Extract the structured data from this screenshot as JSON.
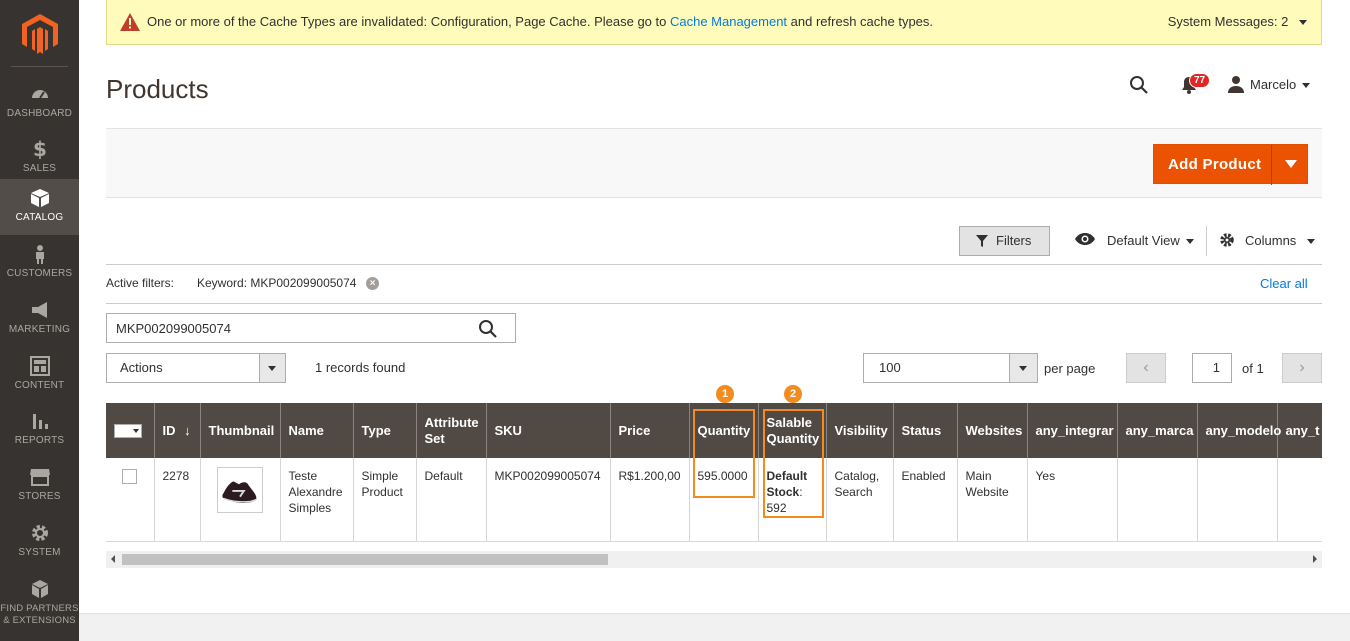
{
  "sidebar": {
    "items": [
      {
        "label": "Dashboard",
        "icon": "dashboard-icon"
      },
      {
        "label": "Sales",
        "icon": "dollar-icon"
      },
      {
        "label": "Catalog",
        "icon": "box-icon"
      },
      {
        "label": "Customers",
        "icon": "person-icon"
      },
      {
        "label": "Marketing",
        "icon": "megaphone-icon"
      },
      {
        "label": "Content",
        "icon": "layout-icon"
      },
      {
        "label": "Reports",
        "icon": "bar-chart-icon"
      },
      {
        "label": "Stores",
        "icon": "store-icon"
      },
      {
        "label": "System",
        "icon": "gear-icon"
      },
      {
        "label": "Find Partners & Extensions",
        "icon": "cubes-icon"
      }
    ]
  },
  "system_message": {
    "text_before": "One or more of the Cache Types are invalidated: Configuration, Page Cache. Please go to ",
    "link": "Cache Management",
    "text_after": " and refresh cache types.",
    "count_label": "System Messages: 2"
  },
  "header": {
    "title": "Products",
    "notifications": "77",
    "user": "Marcelo"
  },
  "toolbar": {
    "add_product": "Add Product",
    "filters": "Filters",
    "view": "Default View",
    "columns": "Columns"
  },
  "active_filters": {
    "label": "Active filters:",
    "keyword": "Keyword: MKP002099005074",
    "clear_all": "Clear all"
  },
  "search": {
    "value": "MKP002099005074"
  },
  "grid_controls": {
    "actions": "Actions",
    "records": "1 records found",
    "per_page_value": "100",
    "per_page_label": "per page",
    "current_page": "1",
    "of_pages": "of 1"
  },
  "table": {
    "headers": [
      "ID",
      "Thumbnail",
      "Name",
      "Type",
      "Attribute Set",
      "SKU",
      "Price",
      "Quantity",
      "Salable Quantity",
      "Visibility",
      "Status",
      "Websites",
      "any_integrar",
      "any_marca",
      "any_modelo",
      "any_t"
    ],
    "rows": [
      {
        "id": "2278",
        "name": "Teste Alexandre Simples",
        "type": "Simple Product",
        "attribute_set": "Default",
        "sku": "MKP002099005074",
        "price": "R$1.200,00",
        "quantity": "595.0000",
        "salable_label": "Default Stock",
        "salable_value": "592",
        "visibility": "Catalog, Search",
        "status": "Enabled",
        "websites": "Main Website",
        "any_integrar": "Yes",
        "any_marca": "",
        "any_modelo": "",
        "any_t": ""
      }
    ]
  },
  "annotations": {
    "badge1": "1",
    "badge2": "2"
  },
  "colors": {
    "accent": "#eb5202",
    "sidebar": "#373330",
    "table_header": "#514943",
    "highlight": "#f28c1e",
    "link": "#007bdb"
  }
}
